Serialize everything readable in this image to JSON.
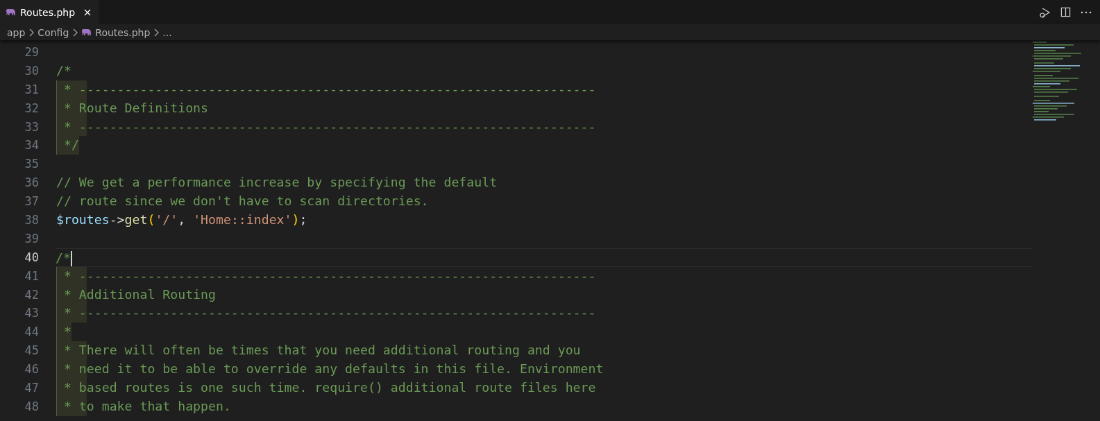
{
  "tabs": [
    {
      "label": "Routes.php",
      "selected": true
    }
  ],
  "breadcrumb": [
    "app",
    "Config",
    "Routes.php",
    "..."
  ],
  "lines": [
    {
      "number": "29",
      "current": false
    },
    {
      "number": "30",
      "current": false,
      "tokens": [
        {
          "kind": "comment",
          "text": "/*"
        }
      ]
    },
    {
      "number": "31",
      "current": false,
      "tokens": [
        {
          "kind": "comment",
          "text": " * --------------------------------------------------------------------"
        }
      ]
    },
    {
      "number": "32",
      "current": false,
      "tokens": [
        {
          "kind": "comment",
          "text": " * Route Definitions"
        }
      ]
    },
    {
      "number": "33",
      "current": false,
      "tokens": [
        {
          "kind": "comment",
          "text": " * --------------------------------------------------------------------"
        }
      ]
    },
    {
      "number": "34",
      "current": false,
      "tokens": [
        {
          "kind": "comment",
          "text": " */"
        }
      ]
    },
    {
      "number": "35",
      "current": false
    },
    {
      "number": "36",
      "current": false,
      "tokens": [
        {
          "kind": "comment",
          "text": "// We get a performance increase by specifying the default"
        }
      ]
    },
    {
      "number": "37",
      "current": false,
      "tokens": [
        {
          "kind": "comment",
          "text": "// route since we don't have to scan directories."
        }
      ]
    },
    {
      "number": "38",
      "current": false,
      "tokens": [
        {
          "kind": "variable",
          "text": "$routes"
        },
        {
          "kind": "operator",
          "text": "->"
        },
        {
          "kind": "function",
          "text": "get"
        },
        {
          "kind": "bracket",
          "text": "("
        },
        {
          "kind": "string",
          "text": "'/'"
        },
        {
          "kind": "operator",
          "text": ", "
        },
        {
          "kind": "string",
          "text": "'Home::index'"
        },
        {
          "kind": "bracket",
          "text": ")"
        },
        {
          "kind": "operator",
          "text": ";"
        }
      ]
    },
    {
      "number": "39",
      "current": false
    },
    {
      "number": "40",
      "current": true,
      "tokens": [
        {
          "kind": "comment",
          "text": "/*"
        }
      ]
    },
    {
      "number": "41",
      "current": false,
      "tokens": [
        {
          "kind": "comment",
          "text": " * --------------------------------------------------------------------"
        }
      ]
    },
    {
      "number": "42",
      "current": false,
      "tokens": [
        {
          "kind": "comment",
          "text": " * Additional Routing"
        }
      ]
    },
    {
      "number": "43",
      "current": false,
      "tokens": [
        {
          "kind": "comment",
          "text": " * --------------------------------------------------------------------"
        }
      ]
    },
    {
      "number": "44",
      "current": false,
      "tokens": [
        {
          "kind": "comment",
          "text": " *"
        }
      ]
    },
    {
      "number": "45",
      "current": false,
      "tokens": [
        {
          "kind": "comment",
          "text": " * There will often be times that you need additional routing and you"
        }
      ]
    },
    {
      "number": "46",
      "current": false,
      "tokens": [
        {
          "kind": "comment",
          "text": " * need it to be able to override any defaults in this file. Environment"
        }
      ]
    },
    {
      "number": "47",
      "current": false,
      "tokens": [
        {
          "kind": "comment",
          "text": " * based routes is one such time. require() additional route files here"
        }
      ]
    },
    {
      "number": "48",
      "current": false,
      "tokens": [
        {
          "kind": "comment",
          "text": " * to make that happen."
        }
      ]
    }
  ]
}
